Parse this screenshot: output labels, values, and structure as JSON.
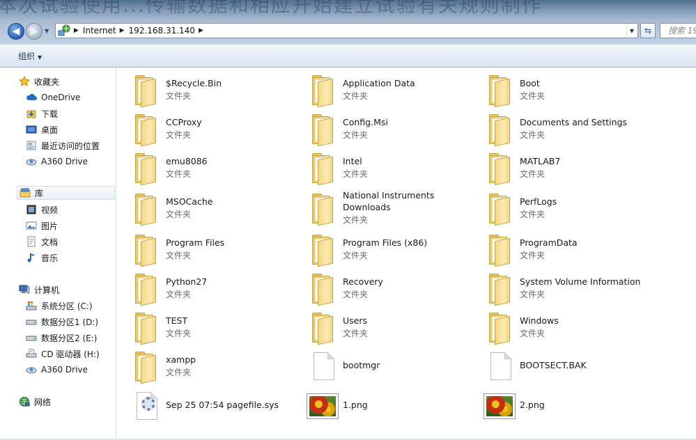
{
  "window": {
    "background_title": "本次试验使用...传输数据和相应开始建立试验有关规则制作",
    "nav_back_label": "◀",
    "nav_forward_label": "▶"
  },
  "address": {
    "breadcrumbs": [
      "Internet",
      "192.168.31.140"
    ],
    "search_placeholder": "搜索 19"
  },
  "commandbar": {
    "organize_label": "组织"
  },
  "sidebar": {
    "favorites": {
      "label": "收藏夹",
      "items": [
        "OneDrive",
        "下载",
        "桌面",
        "最近访问的位置",
        "A360 Drive"
      ]
    },
    "libraries": {
      "label": "库",
      "items": [
        "视频",
        "图片",
        "文档",
        "音乐"
      ]
    },
    "computer": {
      "label": "计算机",
      "items": [
        "系统分区 (C:)",
        "数据分区1 (D:)",
        "数据分区2 (E:)",
        "CD 驱动器 (H:)",
        "A360 Drive"
      ]
    },
    "network": {
      "label": "网络"
    }
  },
  "files": [
    {
      "name": "$Recycle.Bin",
      "type": "文件夹",
      "icon": "folder-icon"
    },
    {
      "name": "Application Data",
      "type": "文件夹",
      "icon": "folder-icon"
    },
    {
      "name": "Boot",
      "type": "文件夹",
      "icon": "folder-icon"
    },
    {
      "name": "CCProxy",
      "type": "文件夹",
      "icon": "folder-icon"
    },
    {
      "name": "Config.Msi",
      "type": "文件夹",
      "icon": "folder-icon"
    },
    {
      "name": "Documents and Settings",
      "type": "文件夹",
      "icon": "folder-icon"
    },
    {
      "name": "emu8086",
      "type": "文件夹",
      "icon": "folder-icon"
    },
    {
      "name": "Intel",
      "type": "文件夹",
      "icon": "folder-icon"
    },
    {
      "name": "MATLAB7",
      "type": "文件夹",
      "icon": "folder-icon"
    },
    {
      "name": "MSOCache",
      "type": "文件夹",
      "icon": "folder-icon"
    },
    {
      "name": "National Instruments Downloads",
      "type": "文件夹",
      "icon": "folder-icon"
    },
    {
      "name": "PerfLogs",
      "type": "文件夹",
      "icon": "folder-icon"
    },
    {
      "name": "Program Files",
      "type": "文件夹",
      "icon": "folder-icon"
    },
    {
      "name": "Program Files (x86)",
      "type": "文件夹",
      "icon": "folder-icon"
    },
    {
      "name": "ProgramData",
      "type": "文件夹",
      "icon": "folder-icon"
    },
    {
      "name": "Python27",
      "type": "文件夹",
      "icon": "folder-icon"
    },
    {
      "name": "Recovery",
      "type": "文件夹",
      "icon": "folder-icon"
    },
    {
      "name": "System Volume Information",
      "type": "文件夹",
      "icon": "folder-icon"
    },
    {
      "name": "TEST",
      "type": "文件夹",
      "icon": "folder-icon"
    },
    {
      "name": "Users",
      "type": "文件夹",
      "icon": "folder-icon"
    },
    {
      "name": "Windows",
      "type": "文件夹",
      "icon": "folder-icon"
    },
    {
      "name": "xampp",
      "type": "文件夹",
      "icon": "folder-icon"
    },
    {
      "name": "bootmgr",
      "type": "",
      "icon": "file-icon"
    },
    {
      "name": "BOOTSECT.BAK",
      "type": "",
      "icon": "file-icon"
    },
    {
      "name": "Sep 25 07:54 pagefile.sys",
      "type": "",
      "icon": "system-file-icon"
    },
    {
      "name": "1.png",
      "type": "",
      "icon": "image-file-icon"
    },
    {
      "name": "2.png",
      "type": "",
      "icon": "image-file-icon"
    }
  ]
}
